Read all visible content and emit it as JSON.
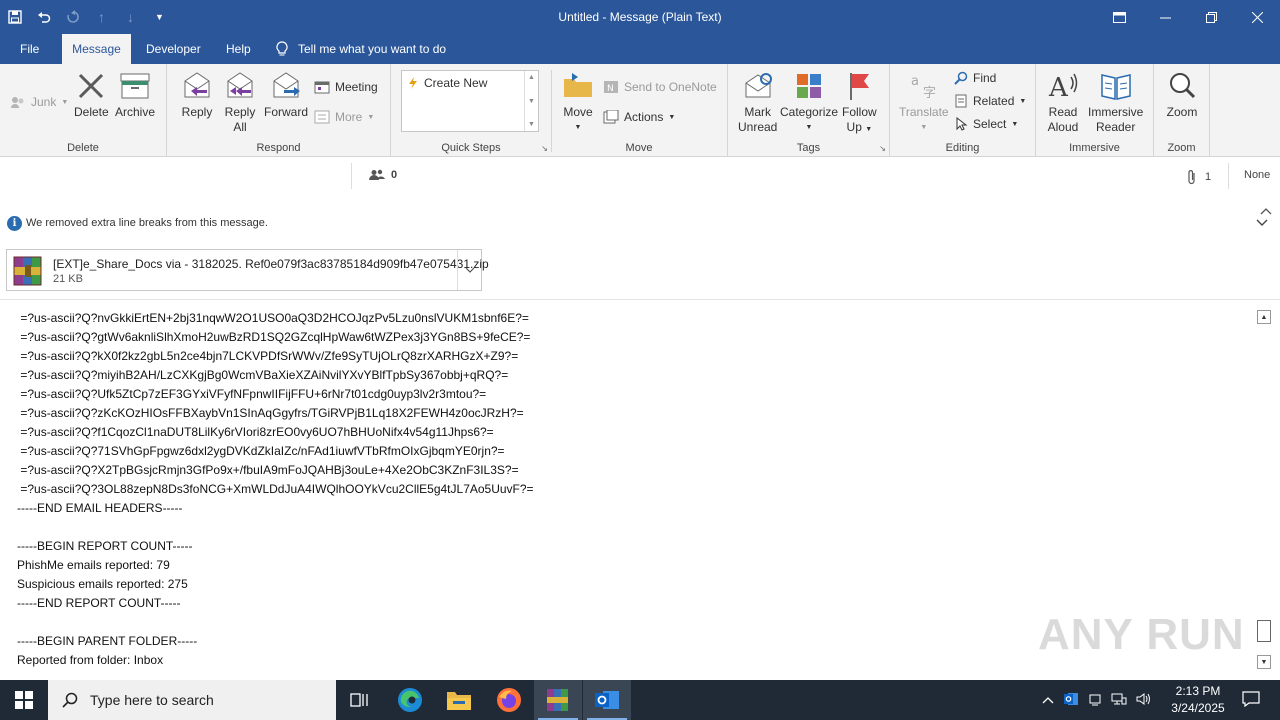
{
  "window": {
    "title": "Untitled  -  Message (Plain Text)",
    "qat_icons": [
      "save-icon",
      "undo-icon",
      "redo-icon",
      "up-icon",
      "down-icon",
      "customize-icon"
    ]
  },
  "menu": {
    "tabs": [
      "File",
      "Message",
      "Developer",
      "Help"
    ],
    "active_tab": "Message",
    "tell_me": "Tell me what you want to do"
  },
  "ribbon": {
    "delete_group": {
      "label": "Delete",
      "junk": "Junk",
      "delete": "Delete",
      "archive": "Archive"
    },
    "respond_group": {
      "label": "Respond",
      "reply": "Reply",
      "reply_all_1": "Reply",
      "reply_all_2": "All",
      "forward": "Forward",
      "meeting": "Meeting",
      "more": "More"
    },
    "quick_steps_group": {
      "label": "Quick Steps",
      "create_new": "Create New"
    },
    "move_group": {
      "label": "Move",
      "move": "Move",
      "onenote": "Send to OneNote",
      "actions": "Actions"
    },
    "tags_group": {
      "label": "Tags",
      "mark_unread_1": "Mark",
      "mark_unread_2": "Unread",
      "categorize": "Categorize",
      "follow_up_1": "Follow",
      "follow_up_2": "Up"
    },
    "editing_group": {
      "label": "Editing",
      "translate": "Translate",
      "find": "Find",
      "related": "Related",
      "select": "Select"
    },
    "immersive_group": {
      "label": "Immersive",
      "read_aloud_1": "Read",
      "read_aloud_2": "Aloud",
      "immersive_reader_1": "Immersive",
      "immersive_reader_2": "Reader"
    },
    "zoom_group": {
      "label": "Zoom",
      "zoom": "Zoom"
    }
  },
  "header": {
    "people_count": "0",
    "attachment_count": "1",
    "importance": "None"
  },
  "notice": "We removed extra line breaks from this message.",
  "attachment": {
    "name": "[EXT]e_Share_Docs via - 3182025.  Ref0e079f3ac83785184d909fb47e075431.zip",
    "size": "21 KB"
  },
  "body_lines": [
    " =?us-ascii?Q?nvGkkiErtEN+2bj31nqwW2O1USO0aQ3D2HCOJqzPv5Lzu0nslVUKM1sbnf6E?=",
    " =?us-ascii?Q?gtWv6aknliSlhXmoH2uwBzRD1SQ2GZcqlHpWaw6tWZPex3j3YGn8BS+9feCE?=",
    " =?us-ascii?Q?kX0f2kz2gbL5n2ce4bjn7LCKVPDfSrWWv/Zfe9SyTUjOLrQ8zrXARHGzX+Z9?=",
    " =?us-ascii?Q?miyihB2AH/LzCXKgjBg0WcmVBaXieXZAiNvilYXvYBlfTpbSy367obbj+qRQ?=",
    " =?us-ascii?Q?Ufk5ZtCp7zEF3GYxiVFyfNFpnwIIFijFFU+6rNr7t01cdg0uyp3lv2r3mtou?=",
    " =?us-ascii?Q?zKcKOzHIOsFFBXaybVn1SInAqGgyfrs/TGiRVPjB1Lq18X2FEWH4z0ocJRzH?=",
    " =?us-ascii?Q?f1CqozCl1naDUT8LilKy6rVIori8zrEO0vy6UO7hBHUoNifx4v54g11Jhps6?=",
    " =?us-ascii?Q?71SVhGpFpgwz6dxl2ygDVKdZkIaIZc/nFAd1iuwfVTbRfmOIxGjbqmYE0rjn?=",
    " =?us-ascii?Q?X2TpBGsjcRmjn3GfPo9x+/fbuIA9mFoJQAHBj3ouLe+4Xe2ObC3KZnF3IL3S?=",
    " =?us-ascii?Q?3OL88zepN8Ds3foNCG+XmWLDdJuA4IWQlhOOYkVcu2CllE5g4tJL7Ao5UuvF?=",
    "-----END EMAIL HEADERS-----",
    "",
    "-----BEGIN REPORT COUNT-----",
    "PhishMe emails reported: 79",
    "Suspicious emails reported: 275",
    "-----END REPORT COUNT-----",
    "",
    "-----BEGIN PARENT FOLDER-----",
    "Reported from folder: Inbox"
  ],
  "watermark": "ANY RUN",
  "taskbar": {
    "search_placeholder": "Type here to search",
    "time": "2:13 PM",
    "date": "3/24/2025"
  }
}
